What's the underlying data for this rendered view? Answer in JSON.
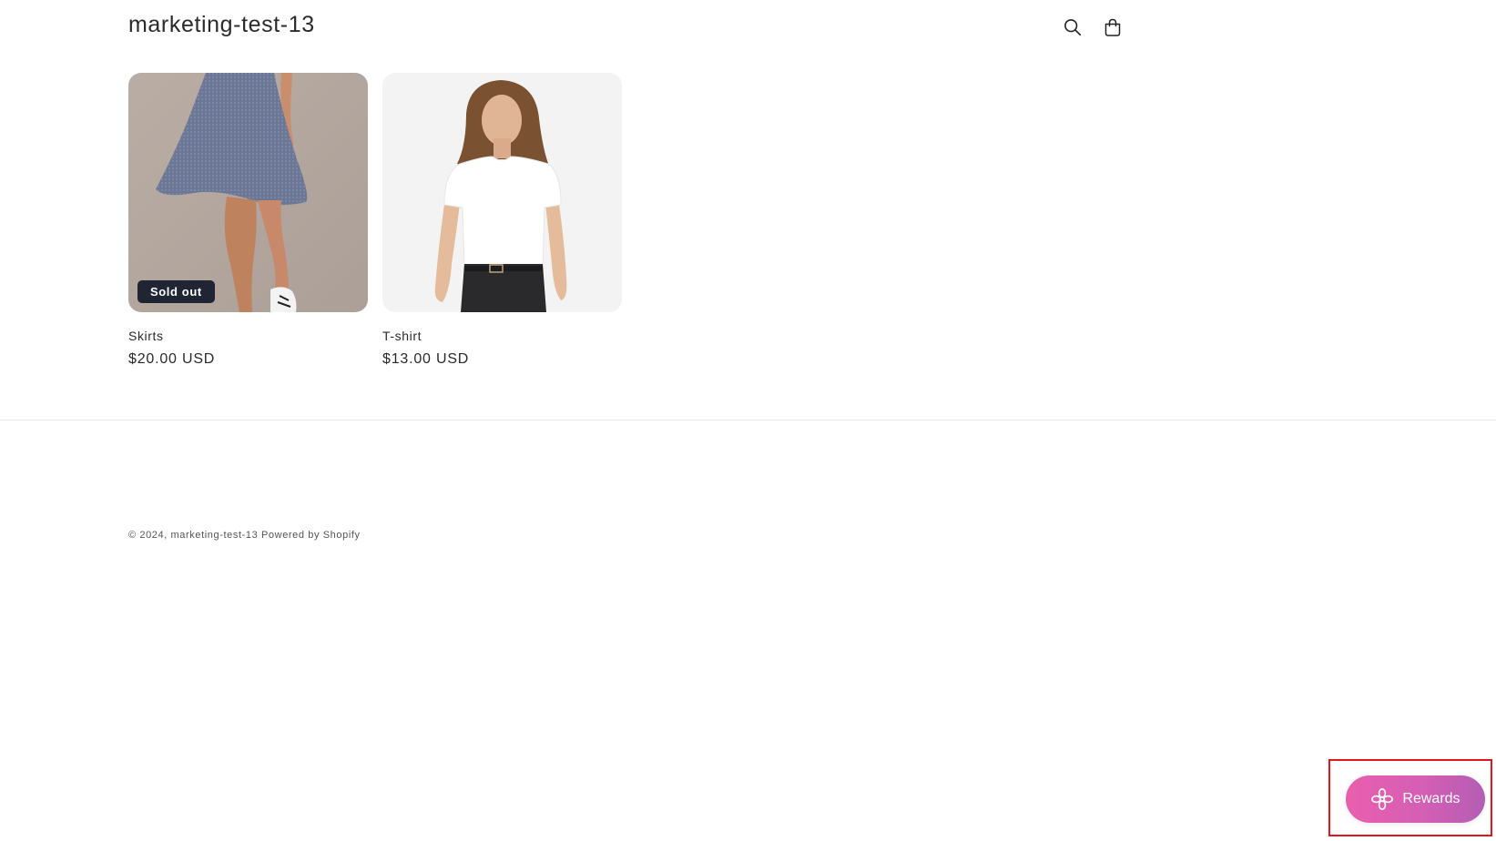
{
  "header": {
    "store_title": "marketing-test-13",
    "search_icon": "search-icon",
    "cart_icon": "cart-icon"
  },
  "products": [
    {
      "title": "Skirts",
      "price": "$20.00 USD",
      "badge": "Sold out",
      "image": "model wearing a blue flared skirt"
    },
    {
      "title": "T-shirt",
      "price": "$13.00 USD",
      "image": "woman wearing a white t-shirt and black jeans"
    }
  ],
  "footer": {
    "copyright": "© 2024,",
    "store_link": "marketing-test-13",
    "powered_by": "Powered by Shopify"
  },
  "rewards": {
    "label": "Rewards",
    "icon": "flower-icon",
    "gradient_start": "#ea5fae",
    "gradient_end": "#b45db4"
  },
  "colors": {
    "highlight": "#e3161b",
    "badge_bg": "#1f2532"
  }
}
